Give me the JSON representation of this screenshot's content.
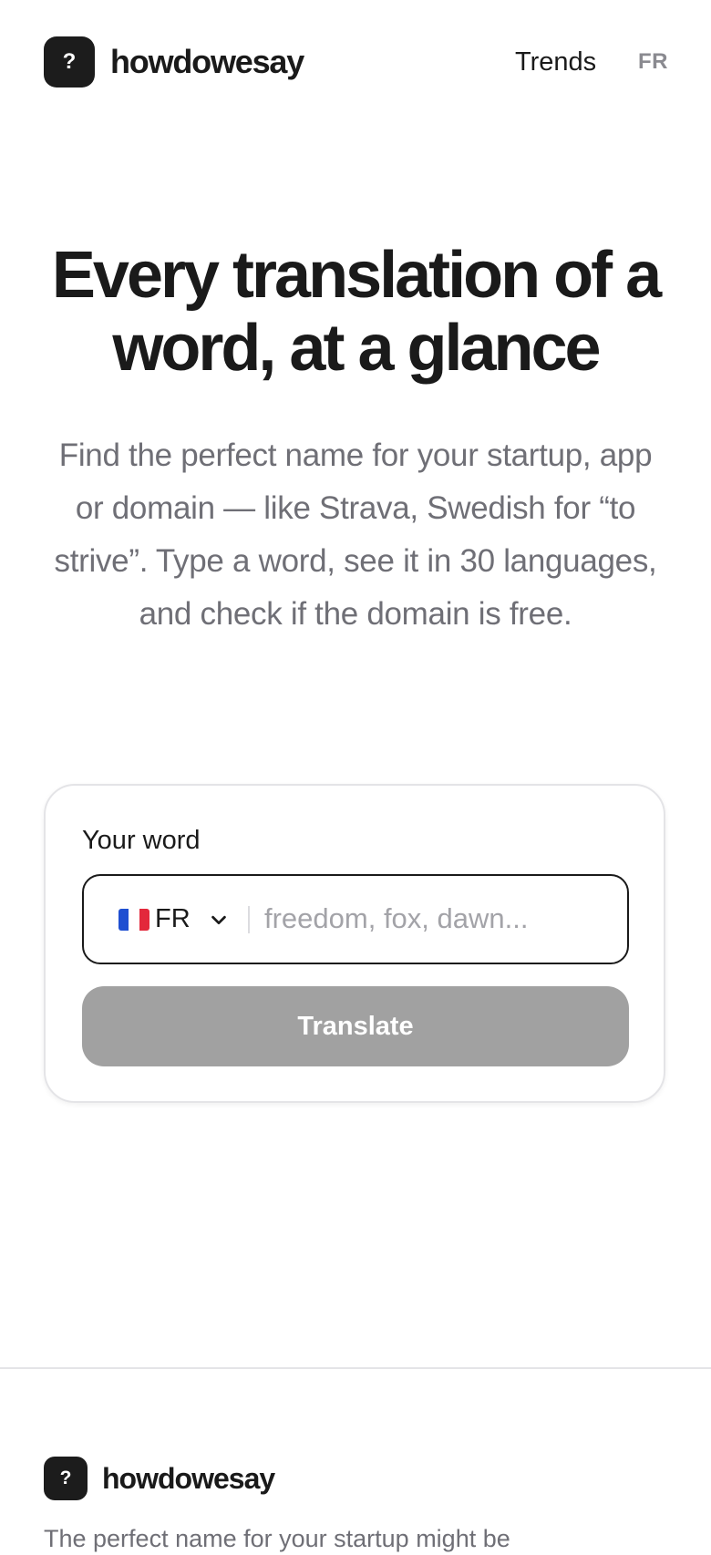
{
  "header": {
    "logo_glyph": "?",
    "brand": "howdowesay",
    "nav_trends": "Trends",
    "nav_language": "FR"
  },
  "hero": {
    "title": "Every translation of a word, at a glance",
    "subtitle": "Find the perfect name for your startup, app or domain — like Strava, Swedish for “to strive”. Type a word, see it in 30 languages, and check if the domain is free."
  },
  "form": {
    "label": "Your word",
    "language_code": "FR",
    "language_flag": "french-flag-icon",
    "word_value": "",
    "word_placeholder": "freedom, fox, dawn...",
    "submit_label": "Translate",
    "submit_color": "#a1a1a1"
  },
  "footer": {
    "logo_glyph": "?",
    "brand": "howdowesay",
    "tagline": "The perfect name for your startup might be"
  },
  "colors": {
    "text": "#1a1a1a",
    "muted": "#6f6f76",
    "logo_bg": "#1c1c1c",
    "border": "#e4e4e7"
  }
}
